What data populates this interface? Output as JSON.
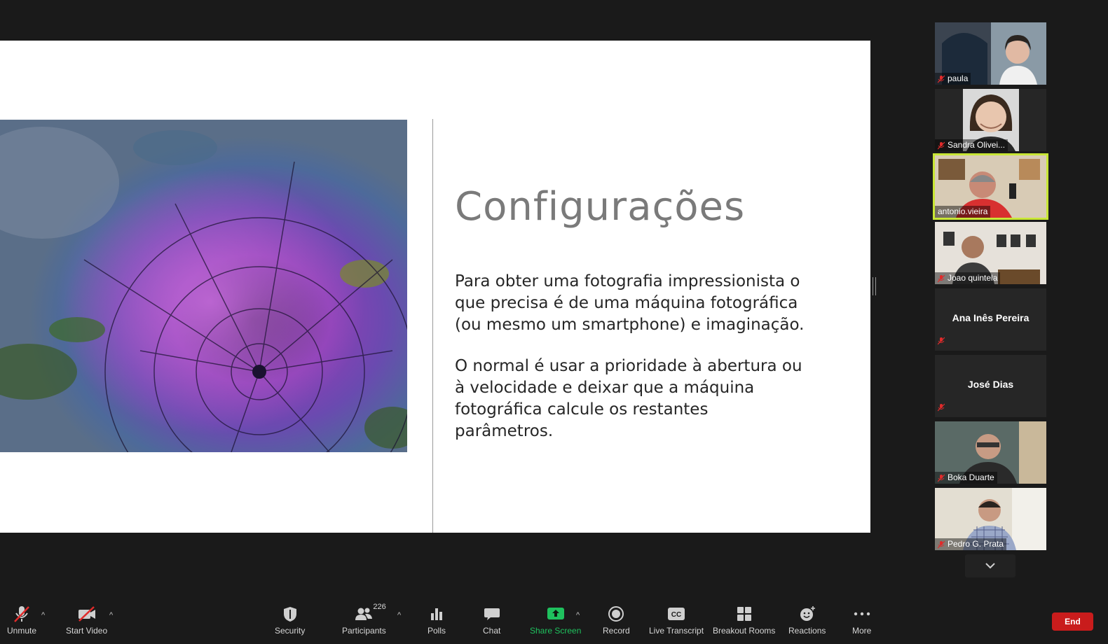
{
  "slide": {
    "title": "Configurações",
    "paragraph_1": "Para obter uma fotografia impressionista o que precisa é de uma máquina fotográfica (ou mesmo um smartphone) e imaginação.",
    "paragraph_2": "O normal é usar a prioridade à abertura ou à velocidade e deixar que a máquina fotográfica calcule os restantes parâmetros."
  },
  "participants_gallery": [
    {
      "name": "paula",
      "video": true,
      "muted": true,
      "active": false
    },
    {
      "name": "Sandra Olivei...",
      "video": true,
      "muted": true,
      "active": false
    },
    {
      "name": "antonio.vieira",
      "video": true,
      "muted": false,
      "active": true
    },
    {
      "name": "Joao quintela",
      "video": true,
      "muted": true,
      "active": false
    },
    {
      "name": "Ana Inês Pereira",
      "video": false,
      "muted": true,
      "active": false
    },
    {
      "name": "José Dias",
      "video": false,
      "muted": true,
      "active": false
    },
    {
      "name": "Boka Duarte",
      "video": true,
      "muted": true,
      "active": false
    },
    {
      "name": "Pedro G. Prata",
      "video": true,
      "muted": true,
      "active": false
    }
  ],
  "toolbar": {
    "unmute": "Unmute",
    "start_video": "Start Video",
    "security": "Security",
    "participants": "Participants",
    "participants_count": "226",
    "polls": "Polls",
    "chat": "Chat",
    "share_screen": "Share Screen",
    "record": "Record",
    "live_transcript": "Live Transcript",
    "breakout_rooms": "Breakout Rooms",
    "reactions": "Reactions",
    "more": "More",
    "end": "End"
  },
  "colors": {
    "background": "#1a1a1a",
    "active_speaker_border": "#c8e635",
    "share_screen_green": "#1fc15e",
    "end_red": "#c91c1c",
    "muted_red": "#e02b2b"
  }
}
